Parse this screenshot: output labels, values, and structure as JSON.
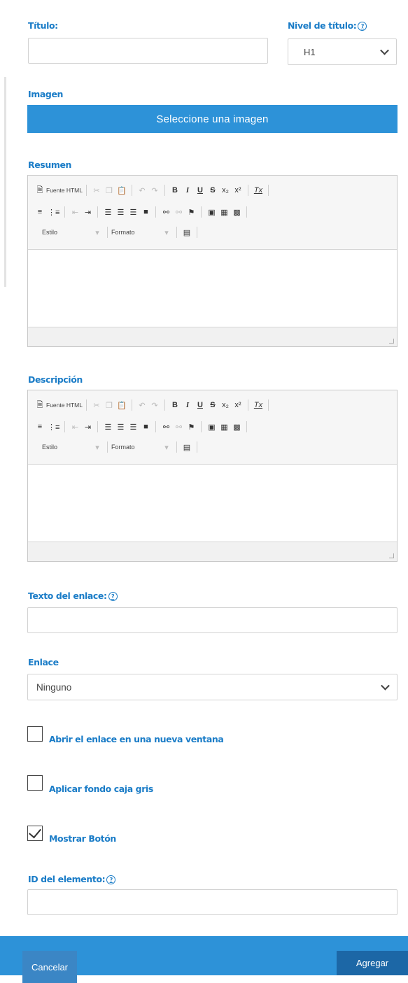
{
  "form": {
    "titulo_label": "Título:",
    "nivel_label": "Nivel de título:",
    "nivel_value": "H1",
    "imagen_label": "Imagen",
    "imagen_button": "Seleccione una imagen",
    "resumen_label": "Resumen",
    "descripcion_label": "Descripción",
    "texto_enlace_label": "Texto del enlace:",
    "enlace_label": "Enlace",
    "enlace_value": "Ninguno",
    "id_label": "ID del elemento:",
    "help_glyph": "?"
  },
  "editor_toolbar": {
    "source_label": "Fuente HTML",
    "bold": "B",
    "italic": "I",
    "underline": "U",
    "strike": "S",
    "subscript": "x₂",
    "superscript": "x²",
    "remove_format": "Tx",
    "style_label": "Estilo",
    "format_label": "Formato"
  },
  "checkboxes": [
    {
      "label": "Abrir el enlace en una nueva ventana",
      "checked": false
    },
    {
      "label": "Aplicar fondo caja gris",
      "checked": false
    },
    {
      "label": "Mostrar Botón",
      "checked": true
    }
  ],
  "footer": {
    "cancel_label": "Cancelar",
    "add_label": "Agregar"
  },
  "colors": {
    "accent": "#2d92d8",
    "label": "#1a7cc7",
    "add_button": "#1c67a6"
  }
}
